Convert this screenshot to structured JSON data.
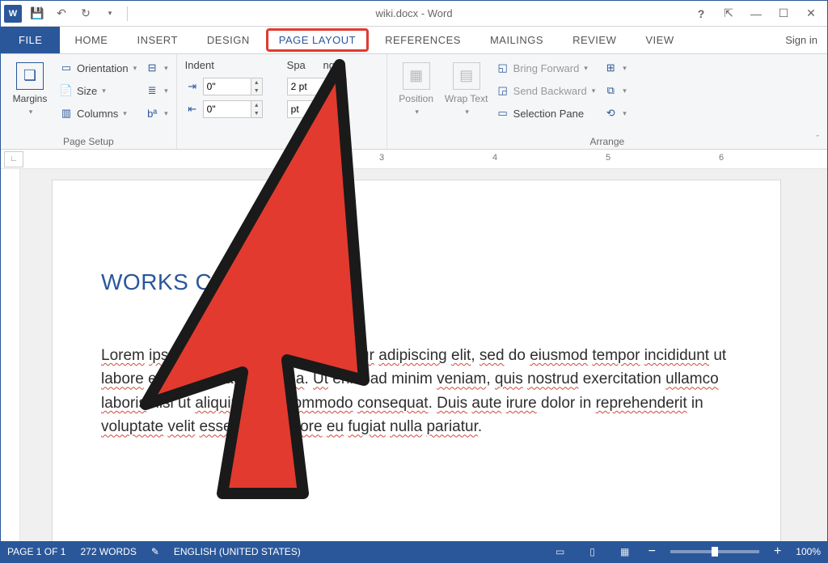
{
  "title": "wiki.docx - Word",
  "tabs": {
    "file": "FILE",
    "home": "HOME",
    "insert": "INSERT",
    "design": "DESIGN",
    "page_layout": "PAGE LAYOUT",
    "references": "REFERENCES",
    "mailings": "MAILINGS",
    "review": "REVIEW",
    "view": "VIEW"
  },
  "signin": "Sign in",
  "ribbon": {
    "page_setup": {
      "margins": "Margins",
      "orientation": "Orientation",
      "size": "Size",
      "columns": "Columns",
      "group_label": "Page Setup"
    },
    "paragraph": {
      "indent_label": "Indent",
      "spacing_label": "Spacing",
      "indent_left": "0\"",
      "indent_right": "0\"",
      "spacing_before": "2 pt",
      "spacing_after": "pt"
    },
    "arrange": {
      "position": "Position",
      "wrap_text": "Wrap Text",
      "bring_forward": "Bring Forward",
      "send_backward": "Send Backward",
      "selection_pane": "Selection Pane",
      "group_label": "Arrange"
    }
  },
  "ruler_numbers": [
    "3",
    "4",
    "5",
    "6"
  ],
  "document": {
    "heading": "WORKS CITED",
    "body": "Lorem ipsum dolor sit amet, consectetur adipiscing elit, sed do eiusmod tempor incididunt ut labore et dolore magna aliqua. Ut enim ad minim veniam, quis nostrud exercitation ullamco laboris nisi ut aliquip ex ea commodo consequat. Duis aute irure dolor in reprehenderit in voluptate velit esse cillum dolore eu fugiat nulla pariatur."
  },
  "statusbar": {
    "page": "PAGE 1 OF 1",
    "words": "272 WORDS",
    "language": "ENGLISH (UNITED STATES)",
    "zoom": "100%"
  }
}
